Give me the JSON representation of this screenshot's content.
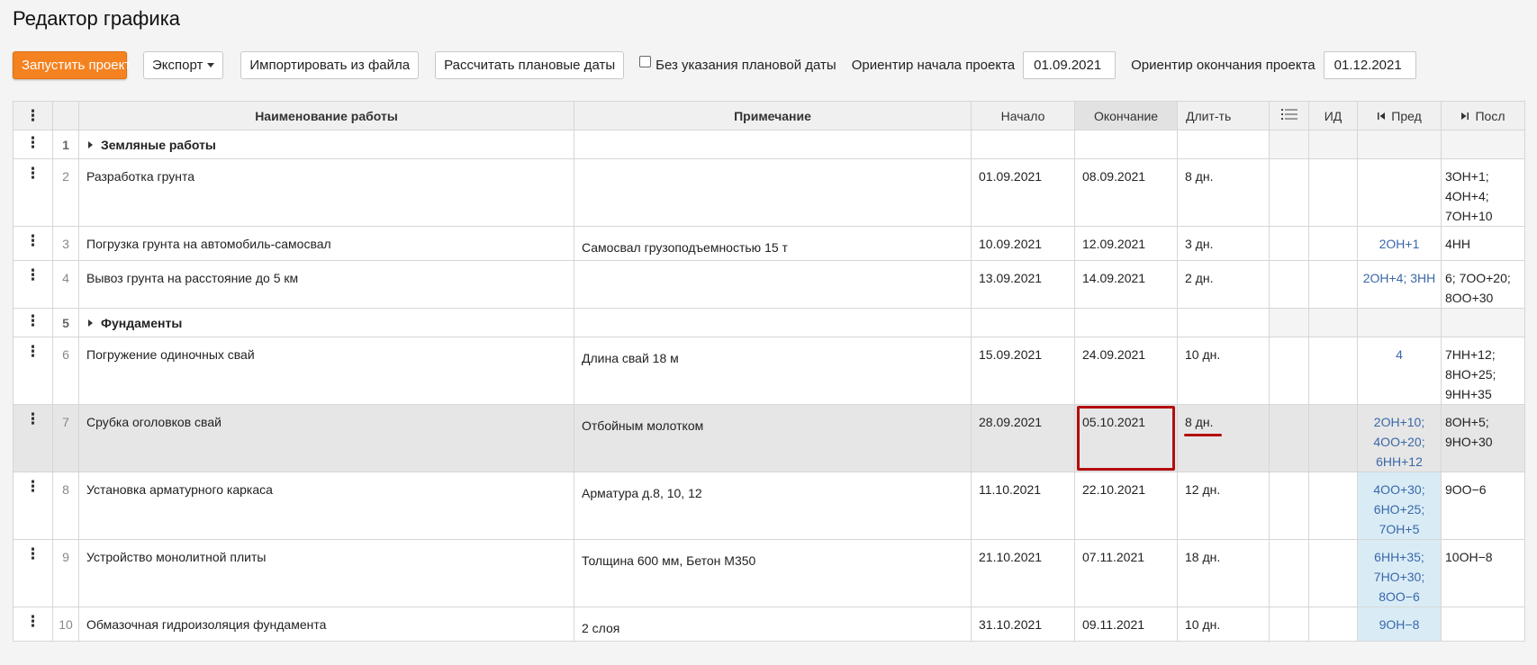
{
  "page": {
    "title": "Редактор графика"
  },
  "toolbar": {
    "start_project_label": "Запустить проект",
    "export_label": "Экспорт",
    "import_label": "Импортировать из файла",
    "calc_dates_label": "Рассчитать плановые даты",
    "no_plan_date_label": "Без указания плановой даты",
    "no_plan_date_checked": false,
    "start_ref_label": "Ориентир начала проекта",
    "start_ref_value": "01.09.2021",
    "end_ref_label": "Ориентир окончания проекта",
    "end_ref_value": "01.12.2021"
  },
  "table": {
    "headers": {
      "menu": "⋮",
      "name": "Наименование работы",
      "note": "Примечание",
      "start": "Начало",
      "end": "Окончание",
      "duration": "Длит-ть",
      "list": "☰",
      "id": "ИД",
      "pred": "Пред",
      "succ": "Посл"
    },
    "rows": [
      {
        "num": "1",
        "name": "Земляные работы",
        "group": true
      },
      {
        "num": "2",
        "name": "Разработка грунта",
        "note": "",
        "start": "01.09.2021",
        "end": "08.09.2021",
        "duration": "8 дн.",
        "pred": [],
        "succ": [
          "3ОН+1;",
          "4ОН+4;",
          "7ОН+10"
        ]
      },
      {
        "num": "3",
        "name": "Погрузка грунта на автомобиль-самосвал",
        "note": "Самосвал грузоподъемностью 15 т",
        "start": "10.09.2021",
        "end": "12.09.2021",
        "duration": "3 дн.",
        "pred": [
          "2ОН+1"
        ],
        "succ": [
          "4НН"
        ]
      },
      {
        "num": "4",
        "name": "Вывоз грунта на расстояние до 5 км",
        "note": "",
        "start": "13.09.2021",
        "end": "14.09.2021",
        "duration": "2 дн.",
        "pred": [
          "2ОН+4; 3НН"
        ],
        "succ": [
          "6; 7ОО+20;",
          "8ОО+30"
        ]
      },
      {
        "num": "5",
        "name": "Фундаменты",
        "group": true
      },
      {
        "num": "6",
        "name": "Погружение одиночных свай",
        "note": "Длина свай 18 м",
        "start": "15.09.2021",
        "end": "24.09.2021",
        "duration": "10 дн.",
        "pred": [
          "4"
        ],
        "succ": [
          "7НН+12;",
          "8НО+25;",
          "9НН+35"
        ]
      },
      {
        "num": "7",
        "name": "Срубка оголовков свай",
        "note": "Отбойным молотком",
        "start": "28.09.2021",
        "end": "05.10.2021",
        "duration": "8 дн.",
        "pred": [
          "2ОН+10;",
          "4ОО+20;",
          "6НН+12"
        ],
        "succ": [
          "8ОН+5;",
          "9НО+30"
        ]
      },
      {
        "num": "8",
        "name": "Установка арматурного каркаса",
        "note": "Арматура д.8, 10, 12",
        "start": "11.10.2021",
        "end": "22.10.2021",
        "duration": "12 дн.",
        "pred": [
          "4ОО+30;",
          "6НО+25;",
          "7ОН+5"
        ],
        "succ": [
          "9ОО−6"
        ]
      },
      {
        "num": "9",
        "name": "Устройство монолитной плиты",
        "note": "Толщина 600 мм, Бетон М350",
        "start": "21.10.2021",
        "end": "07.11.2021",
        "duration": "18 дн.",
        "pred": [
          "6НН+35;",
          "7НО+30;",
          "8ОО−6"
        ],
        "succ": [
          "10ОН−8"
        ]
      },
      {
        "num": "10",
        "name": "Обмазочная гидроизоляция фундамента",
        "note": "2 слоя",
        "start": "31.10.2021",
        "end": "09.11.2021",
        "duration": "10 дн.",
        "pred": [
          "9ОН−8"
        ],
        "succ": []
      }
    ]
  },
  "colors": {
    "primary_button": "#f58220",
    "link_blue": "#3a67a8",
    "highlight_red": "#b30d0d",
    "pred_highlight": "#d9ecf6",
    "selected_row": "#e6e6e6"
  },
  "icons": {
    "row_menu": "vertical-ellipsis-icon",
    "group_toggle": "triangle-right-icon",
    "list": "list-icon",
    "pred": "skip-start-icon",
    "succ": "skip-end-icon"
  }
}
